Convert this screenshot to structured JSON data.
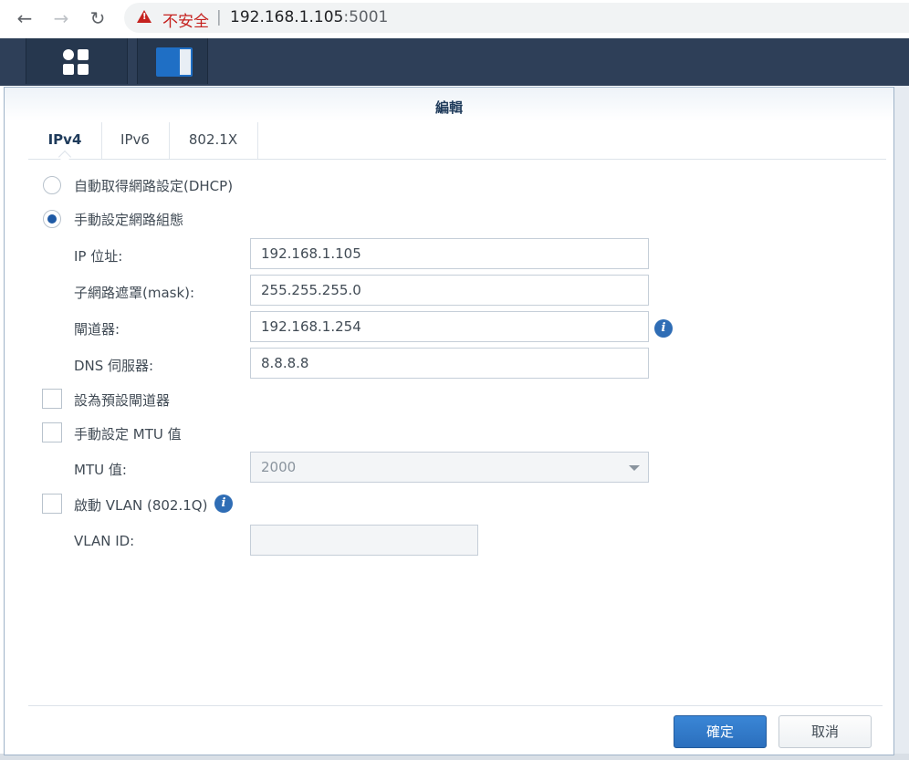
{
  "browser": {
    "security_warning": "不安全",
    "separator": "|",
    "url_host": "192.168.1.105",
    "url_port": ":5001"
  },
  "taskbar": {
    "desktop_icon": "grid-icon",
    "app_icon": "network-settings-icon"
  },
  "dialog": {
    "title": "編輯",
    "tabs": [
      {
        "label": "IPv4"
      },
      {
        "label": "IPv6"
      },
      {
        "label": "802.1X"
      }
    ],
    "dhcp_option": "自動取得網路設定(DHCP)",
    "manual_option": "手動設定網路組態",
    "ip_label": "IP 位址:",
    "ip_value": "192.168.1.105",
    "mask_label": "子網路遮罩(mask):",
    "mask_value": "255.255.255.0",
    "gateway_label": "閘道器:",
    "gateway_value": "192.168.1.254",
    "dns_label": "DNS 伺服器:",
    "dns_value": "8.8.8.8",
    "default_gateway_label": "設為預設閘道器",
    "manual_mtu_label": "手動設定 MTU 值",
    "mtu_label": "MTU 值:",
    "mtu_value": "2000",
    "vlan_label": "啟動 VLAN (802.1Q)",
    "vlan_id_label": "VLAN ID:",
    "vlan_id_value": "",
    "info_glyph": "i",
    "ok_label": "確定",
    "cancel_label": "取消",
    "accent_color": "#2b6fbd"
  }
}
